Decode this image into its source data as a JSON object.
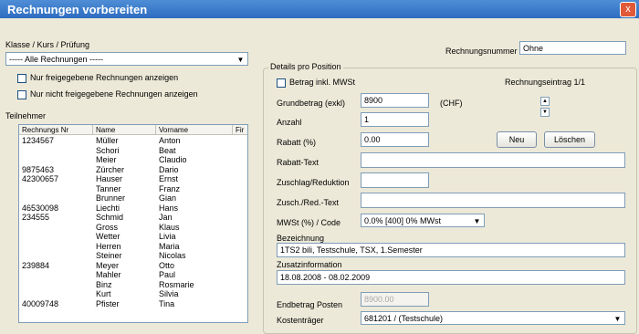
{
  "window": {
    "title": "Rechnungen vorbereiten",
    "close_label": "x"
  },
  "left": {
    "klasse_label": "Klasse / Kurs / Prüfung",
    "klasse_value": "----- Alle Rechnungen -----",
    "nur_freigegeben": "Nur freigegebene Rechnungen anzeigen",
    "nur_nicht_freigegeben": "Nur nicht freigegebene Rechnungen anzeigen",
    "teilnehmer_label": "Teilnehmer",
    "columns": [
      "Rechnungs Nr",
      "Name",
      "Vorname",
      "Fir"
    ],
    "rows": [
      [
        "1234567",
        "Müller",
        "Anton"
      ],
      [
        "",
        "Schori",
        "Beat"
      ],
      [
        "",
        "Meier",
        "Claudio"
      ],
      [
        "9875463",
        "Zürcher",
        "Dario"
      ],
      [
        "42300657",
        "Hauser",
        "Ernst"
      ],
      [
        "",
        "Tanner",
        "Franz"
      ],
      [
        "",
        "Brunner",
        "Gian"
      ],
      [
        "46530098",
        "Liechti",
        "Hans"
      ],
      [
        "234555",
        "Schmid",
        "Jan"
      ],
      [
        "",
        "Gross",
        "Klaus"
      ],
      [
        "",
        "Wetter",
        "Livia"
      ],
      [
        "",
        "Herren",
        "Maria"
      ],
      [
        "",
        "Steiner",
        "Nicolas"
      ],
      [
        "239884",
        "Meyer",
        "Otto"
      ],
      [
        "",
        "Mahler",
        "Paul"
      ],
      [
        "",
        "Binz",
        "Rosmarie"
      ],
      [
        "",
        "Kurt",
        "Silvia"
      ],
      [
        "40009748",
        "Pfister",
        "Tina"
      ]
    ]
  },
  "right": {
    "rechnungsnummer_label": "Rechnungsnummer",
    "rechnungsnummer_value": "Ohne",
    "details_title": "Details pro Position",
    "betrag_inkl": "Betrag inkl. MWSt",
    "rechnungseintrag": "Rechnungseintrag 1/1",
    "grundbetrag_label": "Grundbetrag (exkl)",
    "grundbetrag_value": "8900",
    "currency": "(CHF)",
    "anzahl_label": "Anzahl",
    "anzahl_value": "1",
    "rabatt_label": "Rabatt (%)",
    "rabatt_value": "0.00",
    "neu_label": "Neu",
    "loeschen_label": "Löschen",
    "rabatt_text_label": "Rabatt-Text",
    "zuschlag_label": "Zuschlag/Reduktion",
    "zusch_text_label": "Zusch./Red.-Text",
    "mwst_label": "MWSt (%) / Code",
    "mwst_value": "0.0% [400] 0% MWst",
    "bezeichnung_label": "Bezeichnung",
    "bezeichnung_value": "1TS2 bili, Testschule, TSX, 1.Semester",
    "zusatz_label": "Zusatzinformation",
    "zusatz_value": "18.08.2008 - 08.02.2009",
    "endbetrag_label": "Endbetrag Posten",
    "endbetrag_value": "8900.00",
    "kostentraeger_label": "Kostenträger",
    "kostentraeger_value": "681201 / (Testschule)"
  }
}
